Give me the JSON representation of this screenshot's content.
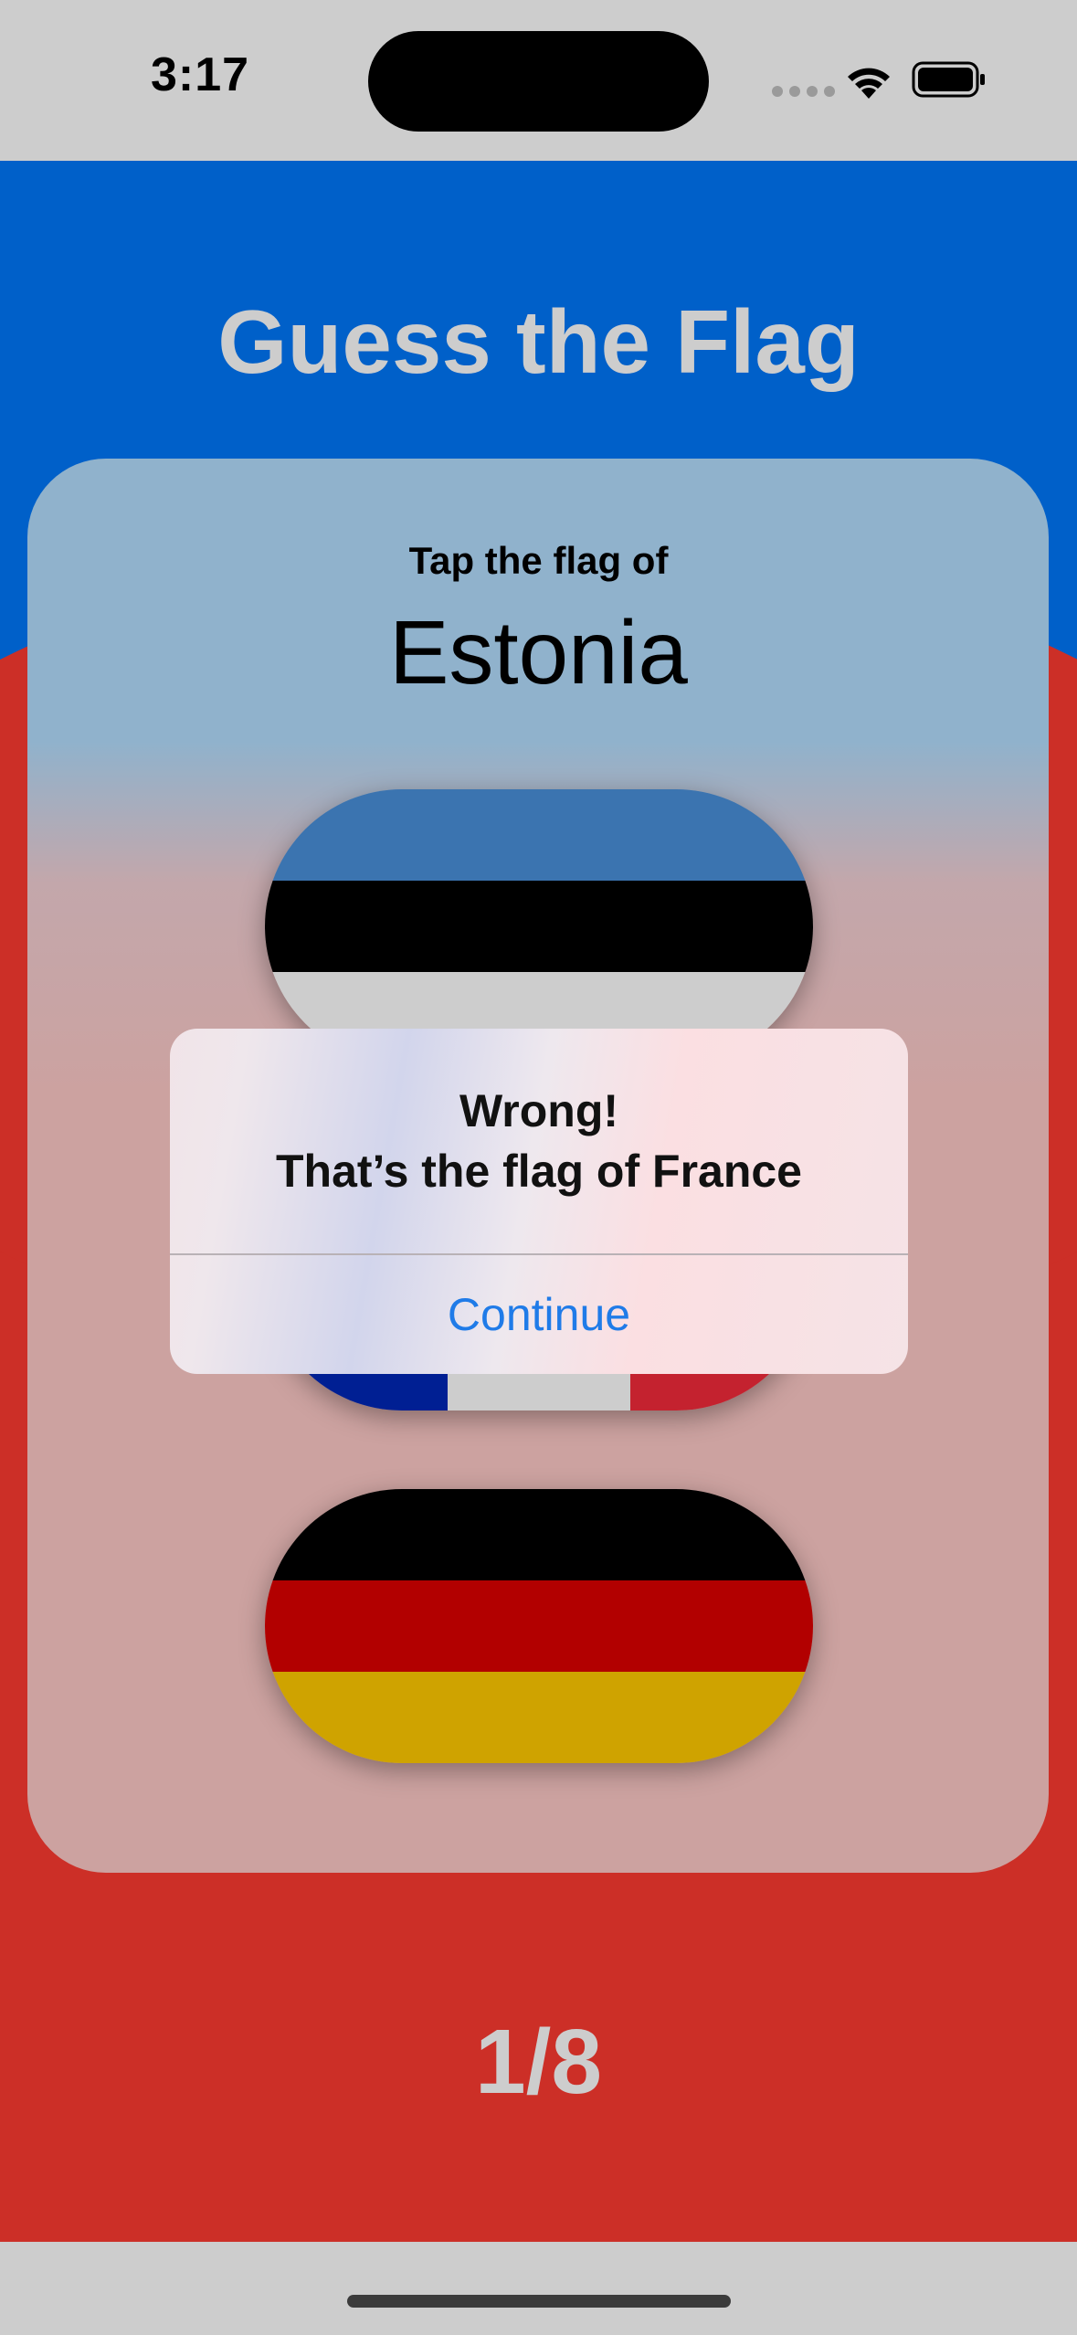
{
  "status_bar": {
    "time": "3:17",
    "icons": [
      "cellular-dots-icon",
      "wifi-icon",
      "battery-icon"
    ]
  },
  "app": {
    "title": "Guess the Flag",
    "prompt": "Tap the flag of",
    "country": "Estonia",
    "progress": "1/8"
  },
  "flags": [
    {
      "country": "Estonia",
      "orientation": "horizontal",
      "stripes": [
        "#3b74b0",
        "#000000",
        "#cdcdcd"
      ]
    },
    {
      "country": "France",
      "orientation": "vertical",
      "stripes": [
        "#001f93",
        "#cdcdcd",
        "#c4222f"
      ]
    },
    {
      "country": "Germany",
      "orientation": "horizontal",
      "stripes": [
        "#000000",
        "#b20000",
        "#cfa300"
      ]
    }
  ],
  "alert": {
    "title": "Wrong!",
    "message": "That’s the flag of France",
    "button_label": "Continue"
  },
  "colors": {
    "background_red": "#cc2f27",
    "background_blue": "#0060c9",
    "title_gray": "#cdcdcd",
    "alert_button_blue": "#1f7be8"
  }
}
